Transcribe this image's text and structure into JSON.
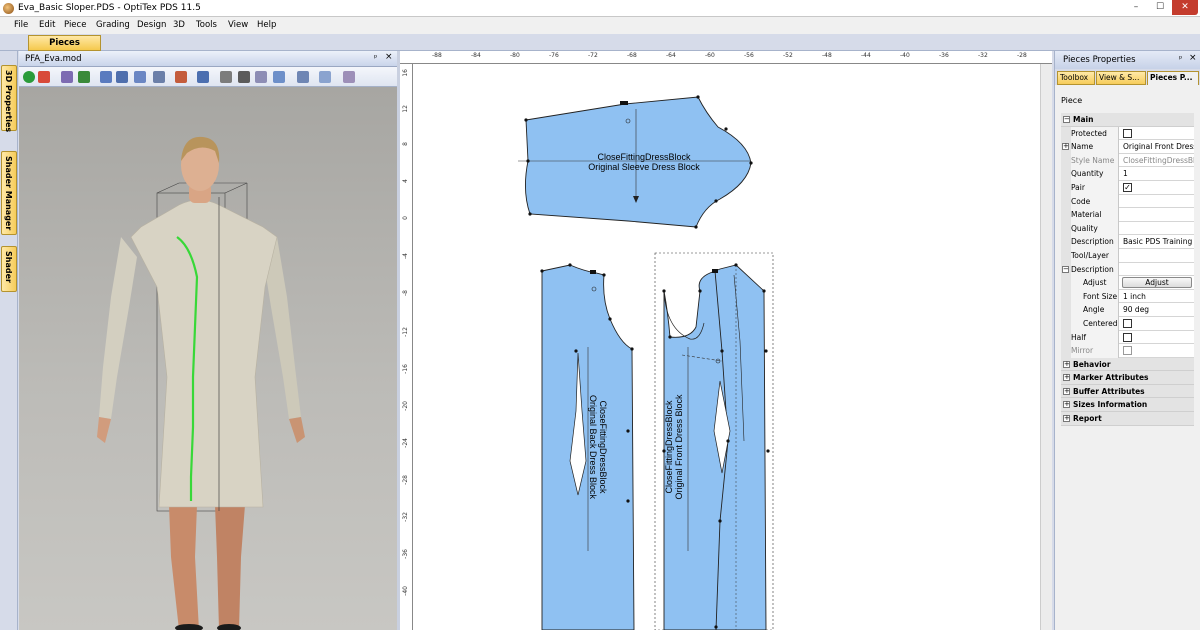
{
  "window": {
    "title": "Eva_Basic Sloper.PDS - OptiTex PDS 11.5",
    "min": "–",
    "max": "☐",
    "close": "✕"
  },
  "menu": [
    "File",
    "Edit",
    "Piece",
    "Grading",
    "Design",
    "3D",
    "Tools",
    "View",
    "Help"
  ],
  "tab_strip": {
    "active_tab": "Pieces Window"
  },
  "side_tabs": [
    "3D Properties",
    "Shader Manager",
    "Shader"
  ],
  "panel3d": {
    "title": "PFA_Eva.mod",
    "pin": "ᵖ",
    "close": "×"
  },
  "ruler_top": [
    "-88",
    "-84",
    "-80",
    "-76",
    "-72",
    "-68",
    "-64",
    "-60",
    "-56",
    "-52",
    "-48",
    "-44",
    "-40",
    "-36",
    "-32",
    "-28"
  ],
  "ruler_left": [
    "16",
    "12",
    "8",
    "4",
    "0",
    "-4",
    "-8",
    "-12",
    "-16",
    "-20",
    "-24",
    "-28",
    "-32",
    "-36",
    "-40"
  ],
  "pieces": [
    {
      "name": "CloseFittingDressBlock",
      "desc": "Original Sleeve Dress Block"
    },
    {
      "name": "CloseFittingDressBlock",
      "desc": "Original Back Dress Block"
    },
    {
      "name": "CloseFittingDressBlock",
      "desc": "Original Front Dress Block"
    }
  ],
  "properties_panel": {
    "title": "Pieces Properties",
    "pin": "ᵖ",
    "close": "×",
    "tabs": [
      "Toolbox",
      "View & S...",
      "Pieces P..."
    ],
    "piece_label": "Piece",
    "main_section": "Main",
    "rows": {
      "protected": {
        "label": "Protected",
        "checked": ""
      },
      "name": {
        "label": "Name",
        "value": "Original Front Dress"
      },
      "style_name": {
        "label": "Style Name",
        "value": "CloseFittingDressBlo"
      },
      "quantity": {
        "label": "Quantity",
        "value": "1"
      },
      "pair": {
        "label": "Pair",
        "checked": "✓"
      },
      "code": {
        "label": "Code",
        "value": ""
      },
      "material": {
        "label": "Material",
        "value": ""
      },
      "quality": {
        "label": "Quality",
        "value": ""
      },
      "description": {
        "label": "Description",
        "value": "Basic PDS Training"
      },
      "tool_layer": {
        "label": "Tool/Layer",
        "value": ""
      },
      "description_group": {
        "label": "Description",
        "value": ""
      },
      "adjust": {
        "label": "Adjust",
        "button": "Adjust"
      },
      "font_size": {
        "label": "Font Size",
        "value": "1 inch"
      },
      "angle": {
        "label": "Angle",
        "value": "90 deg"
      },
      "centered": {
        "label": "Centered",
        "checked": ""
      },
      "half": {
        "label": "Half",
        "checked": ""
      },
      "mirror": {
        "label": "Mirror",
        "checked": ""
      }
    },
    "sections": [
      "Behavior",
      "Marker Attributes",
      "Buffer Attributes",
      "Sizes Information",
      "Report"
    ],
    "toggle_minus": "−",
    "toggle_plus": "+"
  },
  "colors": {
    "piece_fill": "#8fc1f2",
    "accent_tab": "#f6cc5a",
    "seam_green": "#38d838"
  }
}
